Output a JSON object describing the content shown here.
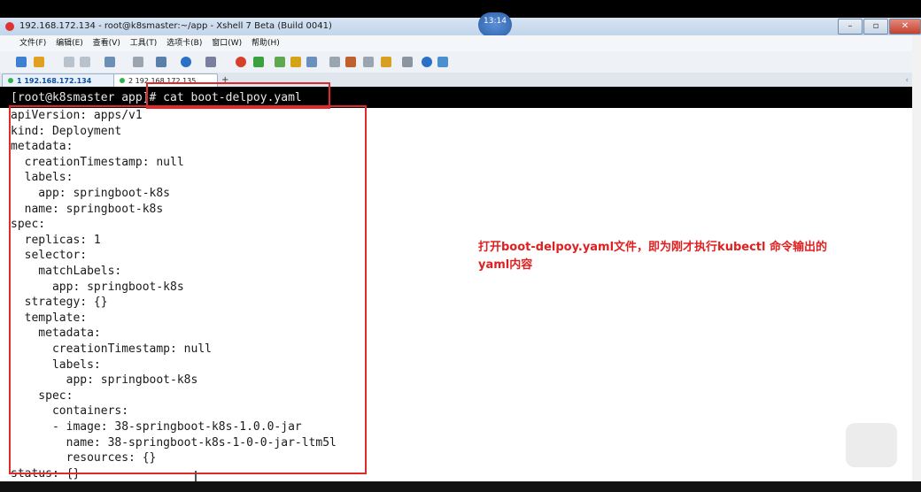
{
  "window": {
    "title": "192.168.172.134 - root@k8smaster:~/app - Xshell 7 Beta (Build 0041)",
    "clock": "13:14"
  },
  "menu": [
    "文件(F)",
    "编辑(E)",
    "查看(V)",
    "工具(T)",
    "选项卡(B)",
    "窗口(W)",
    "帮助(H)"
  ],
  "tabs": [
    {
      "label": "1 192.168.172.134"
    },
    {
      "label": "2 192.168.172.135"
    }
  ],
  "terminal": {
    "command": "[root@k8smaster app]# cat boot-delpoy.yaml",
    "lines": [
      "apiVersion: apps/v1",
      "kind: Deployment",
      "metadata:",
      "  creationTimestamp: null",
      "  labels:",
      "    app: springboot-k8s",
      "  name: springboot-k8s",
      "spec:",
      "  replicas: 1",
      "  selector:",
      "    matchLabels:",
      "      app: springboot-k8s",
      "  strategy: {}",
      "  template:",
      "    metadata:",
      "      creationTimestamp: null",
      "      labels:",
      "        app: springboot-k8s",
      "    spec:",
      "      containers:",
      "      - image: 38-springboot-k8s-1.0.0-jar",
      "        name: 38-springboot-k8s-1-0-0-jar-ltm5l",
      "        resources: {}",
      "status: {}"
    ]
  },
  "annotation": {
    "line1": "打开boot-delpoy.yaml文件，即为刚才执行kubectl 命令输出的",
    "line2": "yaml内容"
  },
  "colors": {
    "annotation": "#e02020",
    "terminal_bg": "#ffffff"
  }
}
